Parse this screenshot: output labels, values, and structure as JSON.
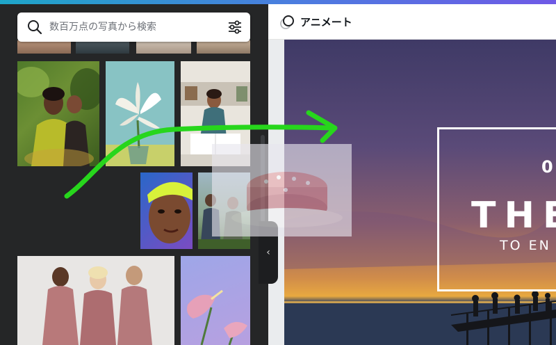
{
  "search": {
    "placeholder": "数百万点の写真から検索",
    "search_icon": "search-icon",
    "filter_icon": "sliders-icon"
  },
  "editor": {
    "animate_label": "アニメート",
    "animate_icon": "animate-icon"
  },
  "canvas_text": {
    "small": "0",
    "big": "THE",
    "sub": "TO EN"
  },
  "colors": {
    "panel_bg": "#252627",
    "accent_green": "#27d61c",
    "header_bg": "#ffffff"
  }
}
